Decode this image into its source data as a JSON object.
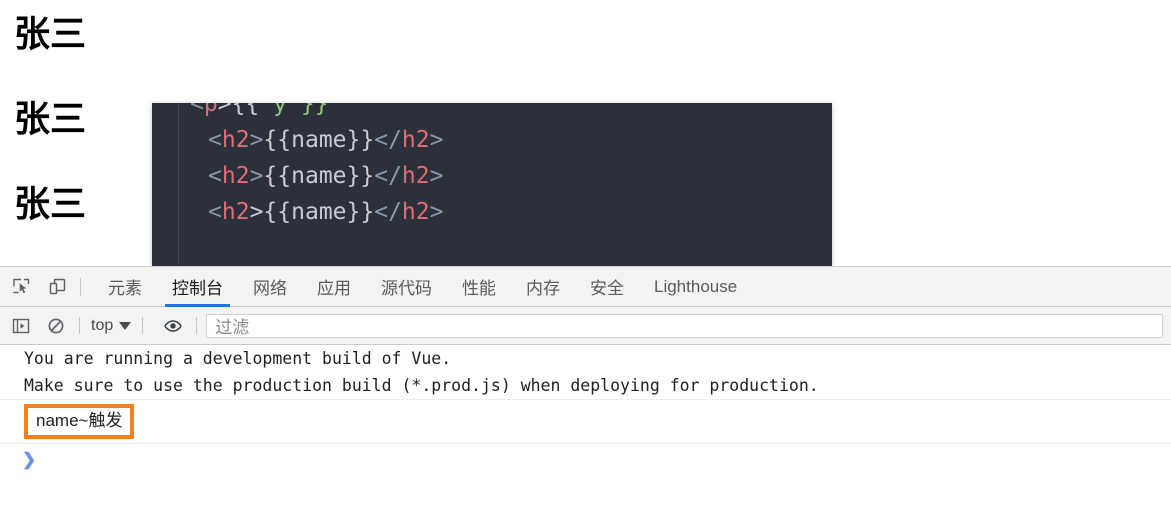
{
  "page": {
    "headings": [
      "张三",
      "张三",
      "张三"
    ]
  },
  "code_overlay": {
    "language": "html",
    "lines": [
      {
        "segments": [
          {
            "text": "<",
            "cls": "tok-punct"
          },
          {
            "text": "p",
            "cls": "tok-tag"
          },
          {
            "text": ">{{ ",
            "cls": "tok-brace"
          },
          {
            "text": "y",
            "cls": "tok-green"
          },
          {
            "text": " }}",
            "cls": "tok-green"
          }
        ],
        "partial": true
      },
      {
        "segments": [
          {
            "text": "<",
            "cls": "tok-punct"
          },
          {
            "text": "h2",
            "cls": "tok-tag"
          },
          {
            "text": ">",
            "cls": "tok-punct"
          },
          {
            "text": "{{",
            "cls": "tok-brace"
          },
          {
            "text": "name",
            "cls": "tok-name"
          },
          {
            "text": "}}",
            "cls": "tok-brace"
          },
          {
            "text": "</",
            "cls": "tok-punct"
          },
          {
            "text": "h2",
            "cls": "tok-tag"
          },
          {
            "text": ">",
            "cls": "tok-punct"
          }
        ],
        "partial": false
      },
      {
        "segments": [
          {
            "text": "<",
            "cls": "tok-punct"
          },
          {
            "text": "h2",
            "cls": "tok-tag"
          },
          {
            "text": ">",
            "cls": "tok-punct"
          },
          {
            "text": "{{",
            "cls": "tok-brace"
          },
          {
            "text": "name",
            "cls": "tok-name"
          },
          {
            "text": "}}",
            "cls": "tok-brace"
          },
          {
            "text": "</",
            "cls": "tok-punct"
          },
          {
            "text": "h2",
            "cls": "tok-tag"
          },
          {
            "text": ">",
            "cls": "tok-punct"
          }
        ],
        "partial": false
      },
      {
        "segments": [
          {
            "text": "<",
            "cls": "tok-punct"
          },
          {
            "text": "h2",
            "cls": "tok-tag"
          },
          {
            "text": ">",
            "cls": "tok-brace"
          },
          {
            "text": "{{",
            "cls": "tok-brace"
          },
          {
            "text": "name",
            "cls": "tok-name"
          },
          {
            "text": "}}",
            "cls": "tok-brace"
          },
          {
            "text": "</",
            "cls": "tok-punct"
          },
          {
            "text": "h2",
            "cls": "tok-tag"
          },
          {
            "text": ">",
            "cls": "tok-punct"
          }
        ],
        "partial": false
      }
    ],
    "background": "#2b303b"
  },
  "devtools": {
    "tabs": [
      {
        "label": "元素",
        "active": false
      },
      {
        "label": "控制台",
        "active": true
      },
      {
        "label": "网络",
        "active": false
      },
      {
        "label": "应用",
        "active": false
      },
      {
        "label": "源代码",
        "active": false
      },
      {
        "label": "性能",
        "active": false
      },
      {
        "label": "内存",
        "active": false
      },
      {
        "label": "安全",
        "active": false
      },
      {
        "label": "Lighthouse",
        "active": false
      }
    ],
    "active_tab_color": "#1a73e8",
    "icons": {
      "inspect": "inspect-element-icon",
      "device": "device-toolbar-icon",
      "sidebar": "console-sidebar-icon",
      "clear": "clear-console-icon",
      "eye": "live-expression-icon"
    },
    "console_toolbar": {
      "context_label": "top",
      "filter_placeholder": "过滤"
    },
    "console": {
      "messages": [
        {
          "lines": [
            "You are running a development build of Vue.",
            "Make sure to use the production build (*.prod.js) when deploying for production."
          ],
          "highlighted": false
        },
        {
          "lines": [
            "name~触发"
          ],
          "highlighted": true,
          "highlight_color": "#f08020"
        }
      ],
      "prompt_symbol": "❯",
      "prompt_value": ""
    }
  }
}
